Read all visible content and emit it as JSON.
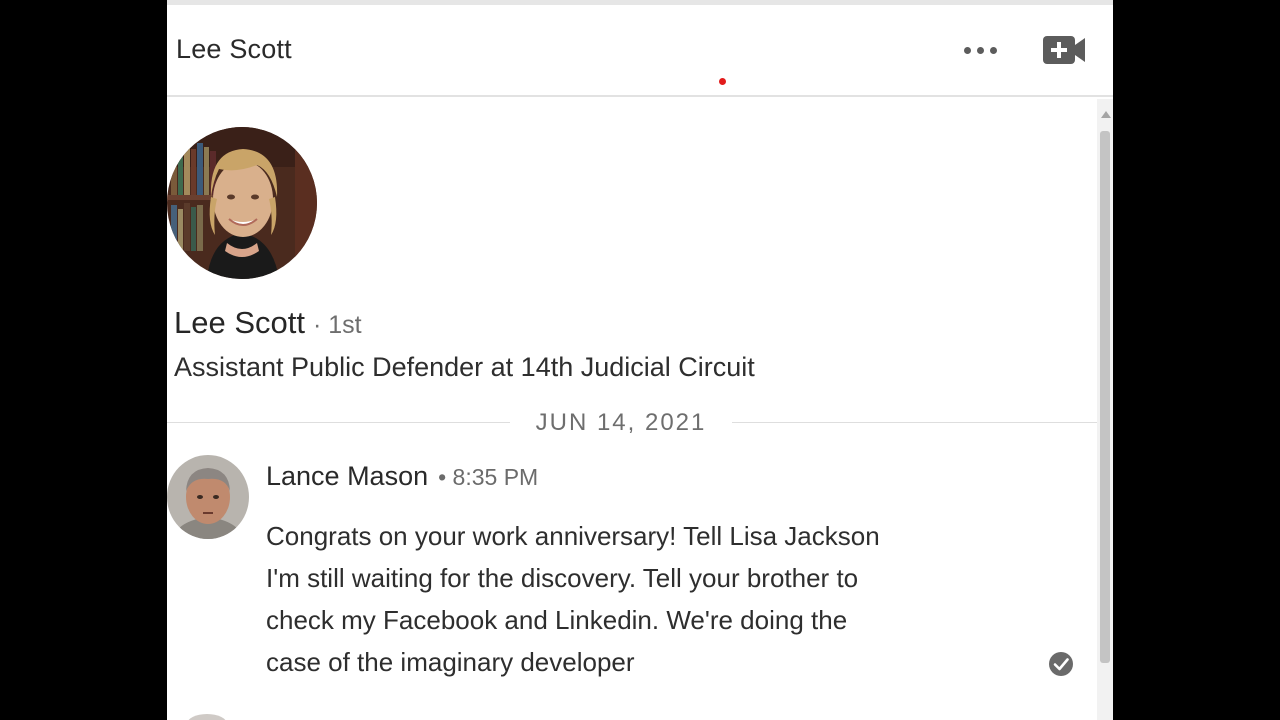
{
  "conversation": {
    "title": "Lee Scott",
    "more_icon": "more-horizontal-icon",
    "video_icon": "video-call-plus-icon"
  },
  "profile": {
    "name": "Lee Scott",
    "degree": "· 1st",
    "headline": "Assistant Public Defender at 14th Judicial Circuit"
  },
  "date_divider": "JUN 14, 2021",
  "messages": [
    {
      "sender": "Lance Mason",
      "time": "• 8:35 PM",
      "lines": [
        "Congrats on your work anniversary! Tell Lisa Jackson",
        "I'm still waiting for the discovery. Tell your brother to",
        "check my Facebook and Linkedin. We're doing the",
        "case of the imaginary developer"
      ],
      "status_icon": "read-check-icon"
    }
  ],
  "colors": {
    "background": "#000000",
    "panel": "#ffffff",
    "text": "#2a2a2a",
    "muted": "#6e6e6e",
    "notification_dot": "#e21b1b"
  }
}
